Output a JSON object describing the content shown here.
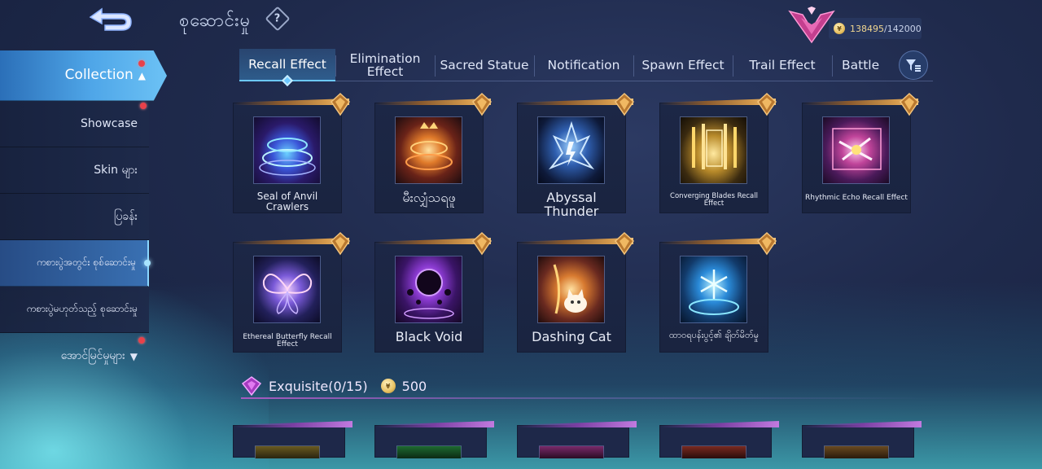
{
  "header": {
    "title": "စုဆောင်းမှု",
    "help_glyph": "?",
    "currency_current": "138495",
    "currency_max": "/142000",
    "coin_glyph": "¥"
  },
  "sidebar": {
    "items": [
      {
        "label": "Collection",
        "active": true,
        "dot": true
      },
      {
        "label": "Showcase",
        "dot": true
      },
      {
        "label": "Skin များ"
      },
      {
        "label": "ပြခန်း"
      },
      {
        "label": "ကစားပွဲအတွင်း စုစ်ဆောင်းမှု",
        "selected": true
      },
      {
        "label": "ကစားပွဲမဟုတ်သည့် စုဆောင်းမှု"
      },
      {
        "label": "အောင်မြင်မှုများ",
        "dot": true
      }
    ]
  },
  "tabs": [
    {
      "label": "Recall Effect",
      "active": true
    },
    {
      "label": "Elimination Effect"
    },
    {
      "label": "Sacred Statue"
    },
    {
      "label": "Notification"
    },
    {
      "label": "Spawn Effect"
    },
    {
      "label": "Trail Effect"
    },
    {
      "label": "Battle"
    }
  ],
  "cards": [
    {
      "name": "Seal of Anvil Crawlers",
      "theme": "blue-ring"
    },
    {
      "name": "မီးလျှံသရဖူ",
      "theme": "fire-crown"
    },
    {
      "name": "Abyssal Thunder",
      "theme": "thunder"
    },
    {
      "name": "Converging Blades Recall Effect",
      "theme": "gold-blades"
    },
    {
      "name": "Rhythmic Echo Recall Effect",
      "theme": "pink-echo"
    },
    {
      "name": "Ethereal Butterfly Recall Effect",
      "theme": "butterfly"
    },
    {
      "name": "Black Void",
      "theme": "void"
    },
    {
      "name": "Dashing Cat",
      "theme": "cat"
    },
    {
      "name": "ထာဝရပန်းပွင့်၏ ချိတ်မိတ်မှု",
      "theme": "snow"
    }
  ],
  "section": {
    "title": "Exquisite(0/15)",
    "price": "500"
  },
  "colors": {
    "accent": "#6cc8ff",
    "gold": "#d59a4c",
    "purple": "#c27ae0",
    "alert": "#e8414a"
  }
}
